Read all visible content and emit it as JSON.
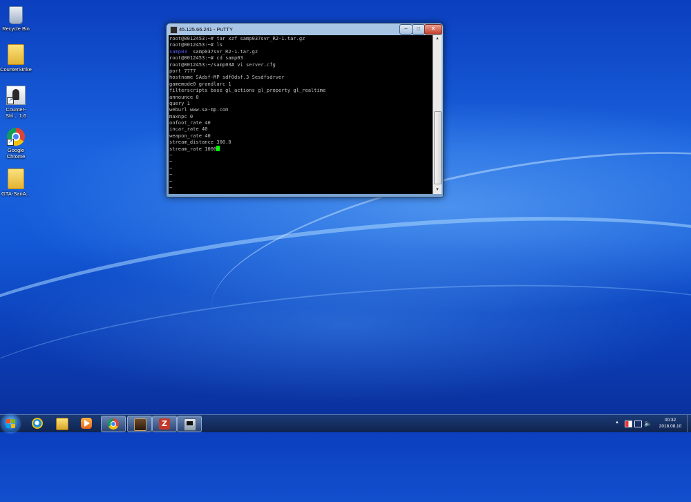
{
  "desktop": {
    "icons": [
      {
        "label": "Recycle Bin"
      },
      {
        "label": "CounterStrike"
      },
      {
        "label": "Counter-Stri... 1.6"
      },
      {
        "label": "Google Chrome"
      },
      {
        "label": "GTA-SanA..."
      }
    ]
  },
  "window": {
    "title": "45.125.66.241 - PuTTY",
    "minimize_glyph": "–",
    "maximize_glyph": "□",
    "close_glyph": "✕"
  },
  "terminal": {
    "lines": [
      "root@0012453:~# tar xzf samp037svr_R2-1.tar.gz",
      "root@0012453:~# ls",
      "samp03",
      "  samp037svr_R2-1.tar.gz",
      "root@0012453:~# cd samp03",
      "root@0012453:~/samp03# vi server.cfg",
      "port 7777",
      "hostname SAdsf-MP sdf0dsf.3 Sesdfsdrver",
      "gamemode0 grandlarc 1",
      "filterscripts base gl_actions gl_property gl_realtime",
      "announce 0",
      "query 1",
      "weburl www.sa-mp.com",
      "maxnpc 0",
      "onfoot_rate 40",
      "incar_rate 40",
      "weapon_rate 40",
      "stream_distance 300.0",
      "stream_rate 1000",
      "~"
    ],
    "colors": {
      "fg": "#c0c0c0",
      "dir": "#5a5af0",
      "cursor": "#00ff00"
    }
  },
  "taskbar": {
    "apps": [
      {
        "name": "internet-explorer-icon"
      },
      {
        "name": "file-explorer-icon"
      },
      {
        "name": "media-player-icon"
      },
      {
        "name": "chrome-icon"
      },
      {
        "name": "game-icon"
      },
      {
        "name": "filezilla-icon"
      },
      {
        "name": "putty-icon"
      }
    ],
    "tray": {
      "arrow": "▲"
    },
    "clock": {
      "time": "00:32",
      "date": "2018.08.10"
    }
  }
}
